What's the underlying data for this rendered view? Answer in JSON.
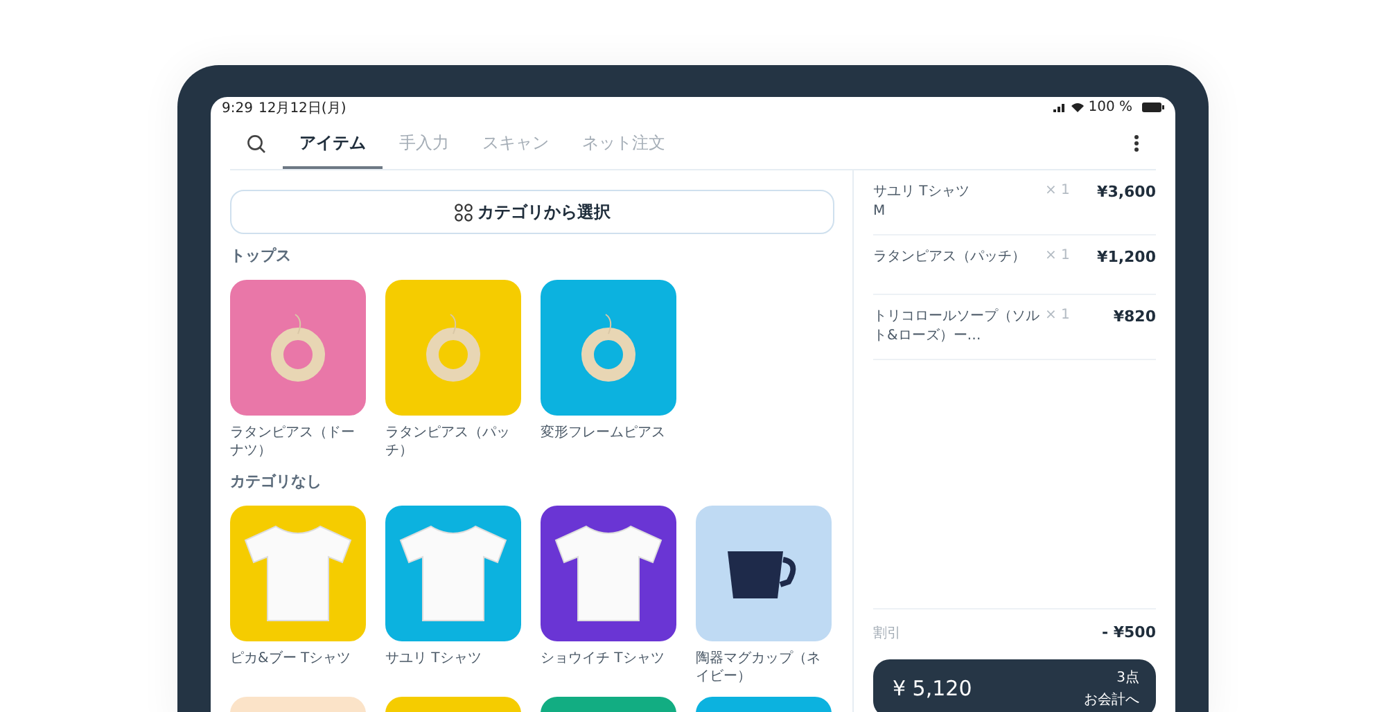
{
  "status_bar": {
    "time": "9:29",
    "date": "12月12日(月)",
    "battery": "100 %"
  },
  "tabs": [
    {
      "label": "アイテム",
      "selected": true
    },
    {
      "label": "手入力",
      "selected": false
    },
    {
      "label": "スキャン",
      "selected": false
    },
    {
      "label": "ネット注文",
      "selected": false
    }
  ],
  "category_button": "カテゴリから選択",
  "sections": [
    {
      "title": "トップス",
      "items": [
        {
          "name": "ラタンピアス（ドーナツ）",
          "kind": "earring",
          "color": "#e977a8"
        },
        {
          "name": "ラタンピアス（パッチ）",
          "kind": "earring",
          "color": "#f5cc00"
        },
        {
          "name": "変形フレームピアス",
          "kind": "earring",
          "color": "#0cb2df"
        }
      ]
    },
    {
      "title": "カテゴリなし",
      "items": [
        {
          "name": "ピカ&ブー Tシャツ",
          "kind": "tshirt",
          "color": "#f5cc00"
        },
        {
          "name": "サユリ Tシャツ",
          "kind": "tshirt",
          "color": "#0cb2df"
        },
        {
          "name": "ショウイチ Tシャツ",
          "kind": "tshirt",
          "color": "#6a35d4"
        },
        {
          "name": "陶器マグカップ（ネイビー）",
          "kind": "mug",
          "color": "#bfdaf3"
        },
        {
          "kind": "unknown",
          "color": "#fbe3c8"
        },
        {
          "kind": "unknown",
          "color": "#f5cc00"
        },
        {
          "kind": "unknown",
          "color": "#12ad82"
        },
        {
          "kind": "unknown",
          "color": "#0cb2df"
        }
      ]
    }
  ],
  "cart": {
    "items": [
      {
        "name": "サユリ Tシャツ",
        "variant": "M",
        "qty": "× 1",
        "price": "¥3,600"
      },
      {
        "name": "ラタンピアス（パッチ）",
        "qty": "× 1",
        "price": "¥1,200"
      },
      {
        "name": "トリコロールソープ（ソルト&ローズ）ー…",
        "qty": "× 1",
        "price": "¥820"
      }
    ],
    "discount": {
      "label": "割引",
      "value": "- ¥500"
    },
    "checkout": {
      "amount": "¥ 5,120",
      "count": "3点",
      "action": "お会計へ"
    }
  }
}
